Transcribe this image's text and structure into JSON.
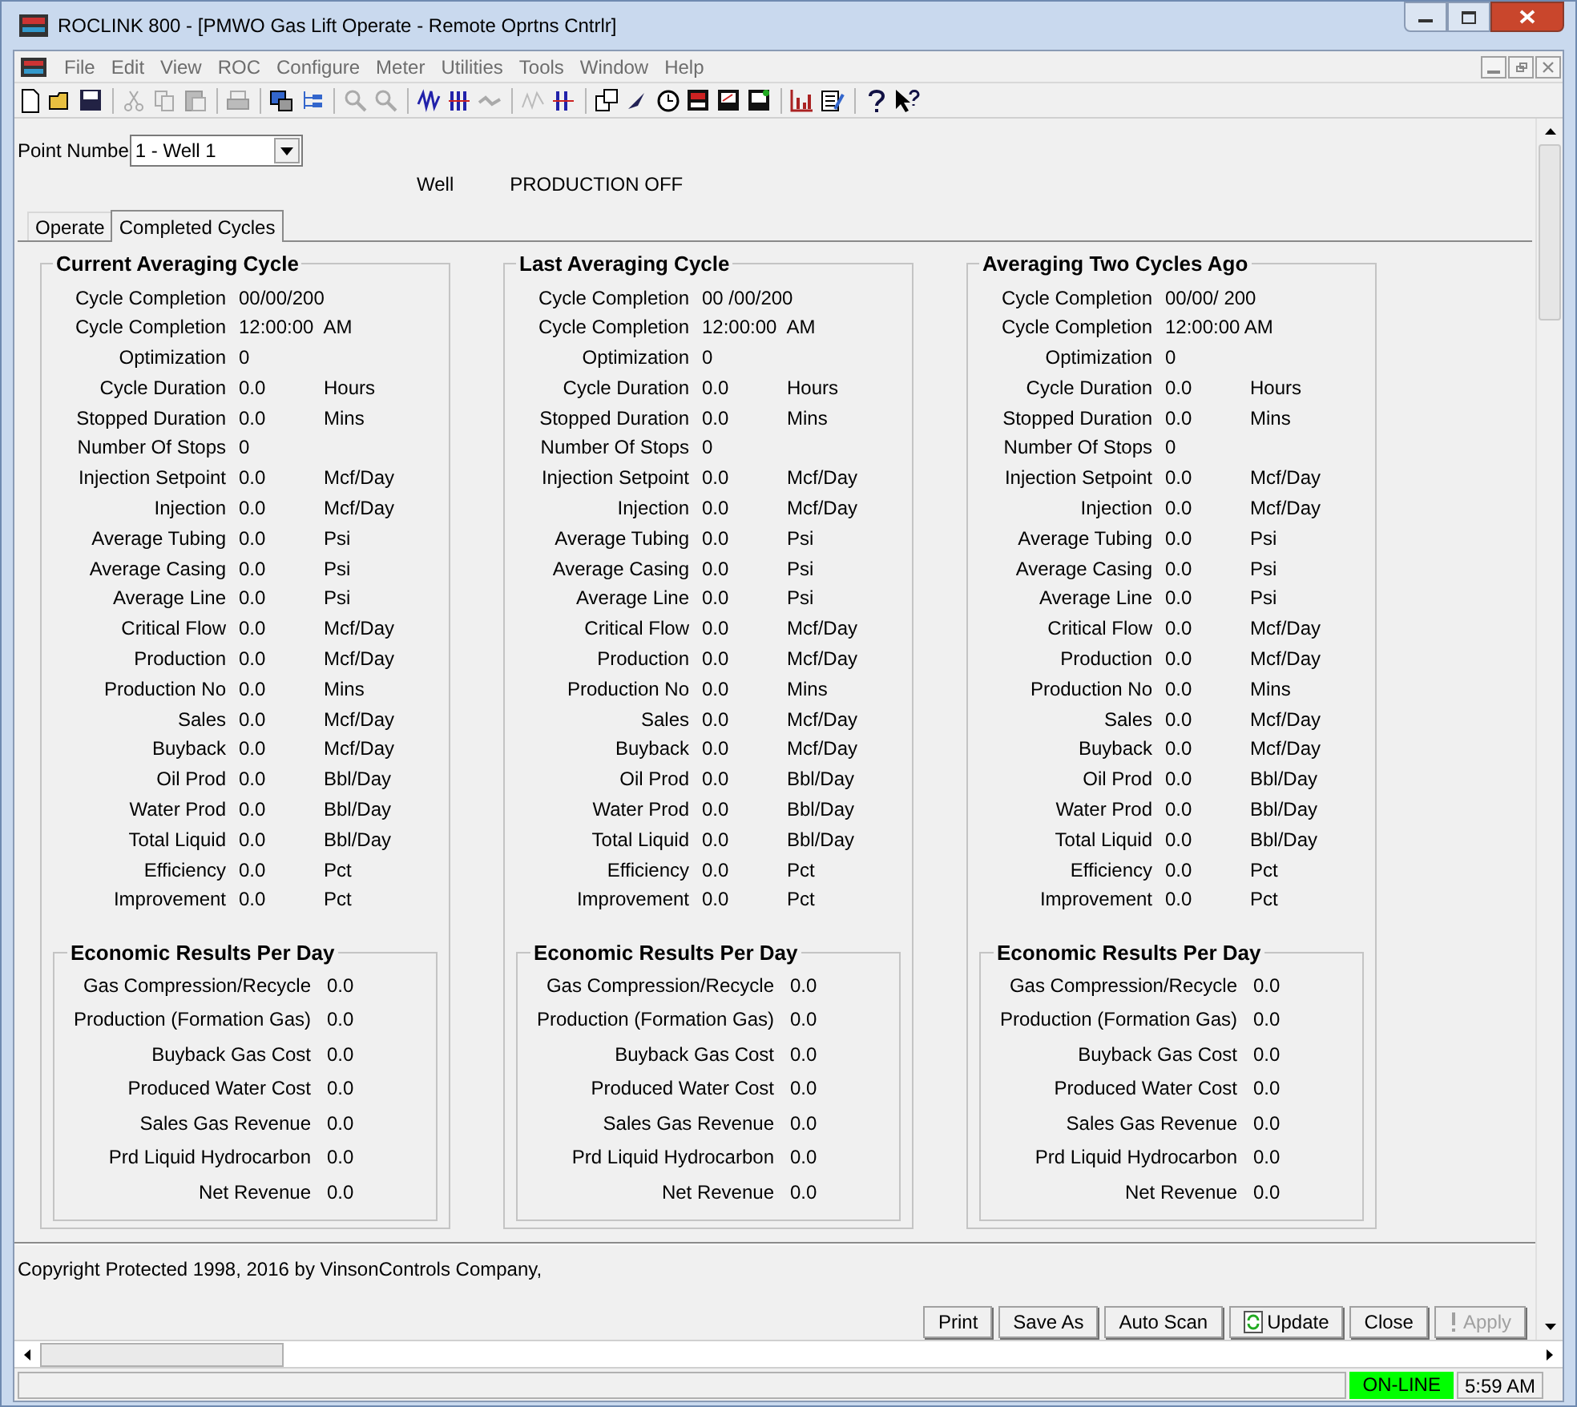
{
  "window": {
    "title": "ROCLINK 800 - [PMWO Gas Lift Operate - Remote Oprtns Cntrlr]"
  },
  "menu": [
    "File",
    "Edit",
    "View",
    "ROC",
    "Configure",
    "Meter",
    "Utilities",
    "Tools",
    "Window",
    "Help"
  ],
  "point": {
    "label": "Point Numbe",
    "value": "1 - Well 1"
  },
  "well": {
    "label": "Well",
    "status": "PRODUCTION OFF"
  },
  "tabs": [
    {
      "label": "Operate",
      "selected": false
    },
    {
      "label": "Completed Cycles",
      "selected": true
    }
  ],
  "cycles": [
    {
      "title": "Current Averaging Cycle",
      "rows": [
        {
          "label": "Cycle Completion",
          "value": "00/00/200",
          "unit": ""
        },
        {
          "label": "Cycle Completion",
          "value": "12:00:00  AM",
          "unit": ""
        },
        {
          "label": "Optimization",
          "value": "0",
          "unit": ""
        },
        {
          "label": "Cycle Duration",
          "value": "0.0",
          "unit": "Hours"
        },
        {
          "label": "Stopped Duration",
          "value": "0.0",
          "unit": "Mins"
        },
        {
          "label": "Number Of Stops",
          "value": "0",
          "unit": ""
        },
        {
          "label": "Injection Setpoint",
          "value": "0.0",
          "unit": "Mcf/Day"
        },
        {
          "label": "Injection",
          "value": "0.0",
          "unit": "Mcf/Day"
        },
        {
          "label": "Average Tubing",
          "value": "0.0",
          "unit": "Psi"
        },
        {
          "label": "Average Casing",
          "value": "0.0",
          "unit": "Psi"
        },
        {
          "label": "Average Line",
          "value": "0.0",
          "unit": "Psi"
        },
        {
          "label": "Critical Flow",
          "value": "0.0",
          "unit": "Mcf/Day"
        },
        {
          "label": "Production",
          "value": "0.0",
          "unit": "Mcf/Day"
        },
        {
          "label": "Production No",
          "value": "0.0",
          "unit": "Mins"
        },
        {
          "label": "Sales",
          "value": "0.0",
          "unit": "Mcf/Day"
        },
        {
          "label": "Buyback",
          "value": "0.0",
          "unit": "Mcf/Day"
        },
        {
          "label": "Oil Prod",
          "value": "0.0",
          "unit": "Bbl/Day"
        },
        {
          "label": "Water Prod",
          "value": "0.0",
          "unit": "Bbl/Day"
        },
        {
          "label": "Total Liquid",
          "value": "0.0",
          "unit": "Bbl/Day"
        },
        {
          "label": "Efficiency",
          "value": "0.0",
          "unit": "Pct"
        },
        {
          "label": "Improvement",
          "value": "0.0",
          "unit": "Pct"
        }
      ],
      "economic": {
        "title": "Economic Results Per Day",
        "rows": [
          {
            "label": "Gas Compression/Recycle",
            "value": "0.0"
          },
          {
            "label": "Production (Formation Gas)",
            "value": "0.0"
          },
          {
            "label": "Buyback Gas Cost",
            "value": "0.0"
          },
          {
            "label": "Produced Water Cost",
            "value": "0.0"
          },
          {
            "label": "Sales Gas Revenue",
            "value": "0.0"
          },
          {
            "label": "Prd Liquid Hydrocarbon",
            "value": "0.0"
          },
          {
            "label": "Net Revenue",
            "value": "0.0"
          }
        ]
      }
    },
    {
      "title": "Last Averaging Cycle",
      "rows": [
        {
          "label": "Cycle Completion",
          "value": "00 /00/200",
          "unit": ""
        },
        {
          "label": "Cycle Completion",
          "value": "12:00:00  AM",
          "unit": ""
        },
        {
          "label": "Optimization",
          "value": "0",
          "unit": ""
        },
        {
          "label": "Cycle Duration",
          "value": "0.0",
          "unit": "Hours"
        },
        {
          "label": "Stopped Duration",
          "value": "0.0",
          "unit": "Mins"
        },
        {
          "label": "Number Of Stops",
          "value": "0",
          "unit": ""
        },
        {
          "label": "Injection Setpoint",
          "value": "0.0",
          "unit": "Mcf/Day"
        },
        {
          "label": "Injection",
          "value": "0.0",
          "unit": "Mcf/Day"
        },
        {
          "label": "Average Tubing",
          "value": "0.0",
          "unit": "Psi"
        },
        {
          "label": "Average Casing",
          "value": "0.0",
          "unit": "Psi"
        },
        {
          "label": "Average Line",
          "value": "0.0",
          "unit": "Psi"
        },
        {
          "label": "Critical Flow",
          "value": "0.0",
          "unit": "Mcf/Day"
        },
        {
          "label": "Production",
          "value": "0.0",
          "unit": "Mcf/Day"
        },
        {
          "label": "Production No",
          "value": "0.0",
          "unit": "Mins"
        },
        {
          "label": "Sales",
          "value": "0.0",
          "unit": "Mcf/Day"
        },
        {
          "label": "Buyback",
          "value": "0.0",
          "unit": "Mcf/Day"
        },
        {
          "label": "Oil Prod",
          "value": "0.0",
          "unit": "Bbl/Day"
        },
        {
          "label": "Water Prod",
          "value": "0.0",
          "unit": "Bbl/Day"
        },
        {
          "label": "Total Liquid",
          "value": "0.0",
          "unit": "Bbl/Day"
        },
        {
          "label": "Efficiency",
          "value": "0.0",
          "unit": "Pct"
        },
        {
          "label": "Improvement",
          "value": "0.0",
          "unit": "Pct"
        }
      ],
      "economic": {
        "title": "Economic Results Per Day",
        "rows": [
          {
            "label": "Gas Compression/Recycle",
            "value": "0.0"
          },
          {
            "label": "Production (Formation Gas)",
            "value": "0.0"
          },
          {
            "label": "Buyback Gas Cost",
            "value": "0.0"
          },
          {
            "label": "Produced Water Cost",
            "value": "0.0"
          },
          {
            "label": "Sales Gas Revenue",
            "value": "0.0"
          },
          {
            "label": "Prd Liquid Hydrocarbon",
            "value": "0.0"
          },
          {
            "label": "Net Revenue",
            "value": "0.0"
          }
        ]
      }
    },
    {
      "title": "Averaging Two Cycles Ago",
      "rows": [
        {
          "label": "Cycle Completion",
          "value": "00/00/ 200",
          "unit": ""
        },
        {
          "label": "Cycle Completion",
          "value": "12:00:00 AM",
          "unit": ""
        },
        {
          "label": "Optimization",
          "value": "0",
          "unit": ""
        },
        {
          "label": "Cycle Duration",
          "value": "0.0",
          "unit": "Hours"
        },
        {
          "label": "Stopped Duration",
          "value": "0.0",
          "unit": "Mins"
        },
        {
          "label": "Number Of Stops",
          "value": "0",
          "unit": ""
        },
        {
          "label": "Injection Setpoint",
          "value": "0.0",
          "unit": "Mcf/Day"
        },
        {
          "label": "Injection",
          "value": "0.0",
          "unit": "Mcf/Day"
        },
        {
          "label": "Average Tubing",
          "value": "0.0",
          "unit": "Psi"
        },
        {
          "label": "Average Casing",
          "value": "0.0",
          "unit": "Psi"
        },
        {
          "label": "Average Line",
          "value": "0.0",
          "unit": "Psi"
        },
        {
          "label": "Critical Flow",
          "value": "0.0",
          "unit": "Mcf/Day"
        },
        {
          "label": "Production",
          "value": "0.0",
          "unit": "Mcf/Day"
        },
        {
          "label": "Production No",
          "value": "0.0",
          "unit": "Mins"
        },
        {
          "label": "Sales",
          "value": "0.0",
          "unit": "Mcf/Day"
        },
        {
          "label": "Buyback",
          "value": "0.0",
          "unit": "Mcf/Day"
        },
        {
          "label": "Oil Prod",
          "value": "0.0",
          "unit": "Bbl/Day"
        },
        {
          "label": "Water Prod",
          "value": "0.0",
          "unit": "Bbl/Day"
        },
        {
          "label": "Total Liquid",
          "value": "0.0",
          "unit": "Bbl/Day"
        },
        {
          "label": "Efficiency",
          "value": "0.0",
          "unit": "Pct"
        },
        {
          "label": "Improvement",
          "value": "0.0",
          "unit": "Pct"
        }
      ],
      "economic": {
        "title": "Economic Results Per Day",
        "rows": [
          {
            "label": "Gas Compression/Recycle",
            "value": "0.0"
          },
          {
            "label": "Production (Formation Gas)",
            "value": "0.0"
          },
          {
            "label": "Buyback Gas Cost",
            "value": "0.0"
          },
          {
            "label": "Produced Water Cost",
            "value": "0.0"
          },
          {
            "label": "Sales Gas Revenue",
            "value": "0.0"
          },
          {
            "label": "Prd Liquid Hydrocarbon",
            "value": "0.0"
          },
          {
            "label": "Net Revenue",
            "value": "0.0"
          }
        ]
      }
    }
  ],
  "copyright": "Copyright Protected 1998, 2016 by VinsonControls Company,",
  "buttons": [
    {
      "label": "Print",
      "disabled": false,
      "kind": "plain"
    },
    {
      "label": "Save As",
      "disabled": false,
      "kind": "plain"
    },
    {
      "label": "Auto Scan",
      "disabled": false,
      "kind": "plain"
    },
    {
      "label": "Update",
      "disabled": false,
      "kind": "update"
    },
    {
      "label": "Close",
      "disabled": false,
      "kind": "plain"
    },
    {
      "label": "Apply",
      "disabled": true,
      "kind": "apply"
    }
  ],
  "status_bar": {
    "connection": "ON-LINE",
    "online": true,
    "time": "5:59 AM"
  }
}
